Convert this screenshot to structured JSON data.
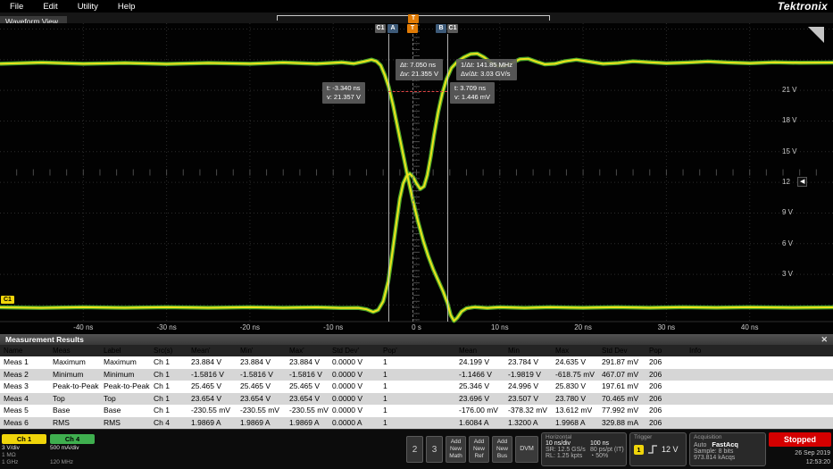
{
  "menu": {
    "items": [
      "File",
      "Edit",
      "Utility",
      "Help"
    ],
    "logo": "Tektronix"
  },
  "view_tab": "Waveform View",
  "icons": {
    "close": "✕",
    "trigger_marker": "◀",
    "position_gauge": "◔"
  },
  "plot": {
    "voltage_labels": [
      {
        "text": "21 V",
        "v": 21
      },
      {
        "text": "18 V",
        "v": 18
      },
      {
        "text": "15 V",
        "v": 15
      },
      {
        "text": "12",
        "v": 12
      },
      {
        "text": "9 V",
        "v": 9
      },
      {
        "text": "6 V",
        "v": 6
      },
      {
        "text": "3 V",
        "v": 3
      }
    ],
    "time_labels": [
      {
        "text": "-40 ns",
        "t": -40
      },
      {
        "text": "-30 ns",
        "t": -30
      },
      {
        "text": "-20 ns",
        "t": -20
      },
      {
        "text": "-10 ns",
        "t": -10
      },
      {
        "text": "0 s",
        "t": 0
      },
      {
        "text": "10 ns",
        "t": 10
      },
      {
        "text": "20 ns",
        "t": 20
      },
      {
        "text": "30 ns",
        "t": 30
      },
      {
        "text": "40 ns",
        "t": 40
      }
    ],
    "cursor_readout": {
      "delta": "Δt: 7.050 ns",
      "delta_v": "Δv: 21.355 V",
      "inv": "1/Δt: 141.85 MHz",
      "slope": "Δv/Δt: 3.03 GV/s",
      "a_t": "t: -3.340 ns",
      "a_v": "v: 21.357 V",
      "b_t": "t: 3.709 ns",
      "b_v": "v: 1.446 mV"
    },
    "markers": {
      "cursor_a": "A",
      "cursor_b": "B",
      "ch_flag": "C1",
      "trigger": "T",
      "channel_badge": "C1"
    },
    "waveforms": {
      "falling_edge": [
        [
          -50,
          23.6
        ],
        [
          -45,
          23.72
        ],
        [
          -40,
          23.6
        ],
        [
          -35,
          23.68
        ],
        [
          -30,
          23.58
        ],
        [
          -25,
          23.68
        ],
        [
          -20,
          23.6
        ],
        [
          -16,
          23.72
        ],
        [
          -12,
          23.6
        ],
        [
          -9,
          23.74
        ],
        [
          -7.5,
          23.62
        ],
        [
          -6.3,
          23.82
        ],
        [
          -5.4,
          24.0
        ],
        [
          -4.8,
          23.85
        ],
        [
          -4.3,
          23.45
        ],
        [
          -3.8,
          22.5
        ],
        [
          -3.34,
          21.36
        ],
        [
          -2.8,
          19.5
        ],
        [
          -2.2,
          17.1
        ],
        [
          -1.6,
          14.7
        ],
        [
          -1,
          12.3
        ],
        [
          -0.4,
          10.1
        ],
        [
          0.2,
          8.1
        ],
        [
          0.8,
          6.3
        ],
        [
          1.4,
          4.8
        ],
        [
          2,
          3.5
        ],
        [
          2.6,
          2.4
        ],
        [
          3.2,
          1.3
        ],
        [
          3.71,
          0.2
        ],
        [
          4.1,
          -1.0
        ],
        [
          4.5,
          -1.56
        ],
        [
          4.9,
          -1.25
        ],
        [
          5.4,
          -0.65
        ],
        [
          6,
          -0.32
        ],
        [
          7,
          -0.2
        ],
        [
          8.5,
          -0.3
        ],
        [
          10,
          -0.22
        ],
        [
          13,
          -0.28
        ],
        [
          16,
          -0.22
        ],
        [
          20,
          -0.27
        ],
        [
          24,
          -0.22
        ],
        [
          28,
          -0.27
        ],
        [
          32,
          -0.22
        ],
        [
          36,
          -0.26
        ],
        [
          40,
          -0.22
        ],
        [
          45,
          -0.26
        ],
        [
          50,
          -0.23
        ]
      ],
      "rising_edge": [
        [
          -50,
          -0.23
        ],
        [
          -45,
          -0.28
        ],
        [
          -40,
          -0.22
        ],
        [
          -35,
          -0.27
        ],
        [
          -30,
          -0.22
        ],
        [
          -25,
          -0.27
        ],
        [
          -20,
          -0.22
        ],
        [
          -16,
          -0.27
        ],
        [
          -12,
          -0.23
        ],
        [
          -9,
          -0.3
        ],
        [
          -7,
          -0.28
        ],
        [
          -6,
          -0.42
        ],
        [
          -5.2,
          -0.68
        ],
        [
          -4.6,
          -0.48
        ],
        [
          -4,
          0.35
        ],
        [
          -3.4,
          2.3
        ],
        [
          -2.9,
          5.1
        ],
        [
          -2.4,
          8.1
        ],
        [
          -2,
          10.4
        ],
        [
          -1.6,
          11.9
        ],
        [
          -1.2,
          12.6
        ],
        [
          -0.8,
          12.85
        ],
        [
          -0.4,
          12.5
        ],
        [
          0,
          11.9
        ],
        [
          0.45,
          11.35
        ],
        [
          0.9,
          11.6
        ],
        [
          1.3,
          12.7
        ],
        [
          1.7,
          14.5
        ],
        [
          2.1,
          16.6
        ],
        [
          2.6,
          18.9
        ],
        [
          3.1,
          20.7
        ],
        [
          3.6,
          22.1
        ],
        [
          4.2,
          23.2
        ],
        [
          4.9,
          23.8
        ],
        [
          5.7,
          24.25
        ],
        [
          6.5,
          24.55
        ],
        [
          7.3,
          24.6
        ],
        [
          8.1,
          24.25
        ],
        [
          8.9,
          23.75
        ],
        [
          9.7,
          23.4
        ],
        [
          10.5,
          23.35
        ],
        [
          11.4,
          23.65
        ],
        [
          12.4,
          24.05
        ],
        [
          13.4,
          24.1
        ],
        [
          14.4,
          23.8
        ],
        [
          15.4,
          23.55
        ],
        [
          16.6,
          23.6
        ],
        [
          17.8,
          23.85
        ],
        [
          19.2,
          24.0
        ],
        [
          20.8,
          23.8
        ],
        [
          22.4,
          23.6
        ],
        [
          24.2,
          23.68
        ],
        [
          26,
          23.85
        ],
        [
          28,
          23.75
        ],
        [
          30,
          23.65
        ],
        [
          32.5,
          23.72
        ],
        [
          35,
          23.82
        ],
        [
          37.5,
          23.72
        ],
        [
          40,
          23.66
        ],
        [
          43,
          23.74
        ],
        [
          46,
          23.7
        ],
        [
          50,
          23.72
        ]
      ]
    }
  },
  "measurements": {
    "title": "Measurement Results",
    "columns": [
      "Name",
      "Meas",
      "Label",
      "Src(s)",
      "Mean'",
      "Min'",
      "Max'",
      "Std Dev'",
      "Pop'",
      "Mean",
      "Min",
      "Max",
      "Std Dev",
      "Pop",
      "Info"
    ],
    "rows": [
      [
        "Meas 1",
        "Maximum",
        "Maximum",
        "Ch 1",
        "23.884 V",
        "23.884 V",
        "23.884 V",
        "0.0000 V",
        "1",
        "24.199 V",
        "23.784 V",
        "24.635 V",
        "291.87 mV",
        "206",
        ""
      ],
      [
        "Meas 2",
        "Minimum",
        "Minimum",
        "Ch 1",
        "-1.5816 V",
        "-1.5816 V",
        "-1.5816 V",
        "0.0000 V",
        "1",
        "-1.1466 V",
        "-1.9819 V",
        "-618.75 mV",
        "467.07 mV",
        "206",
        ""
      ],
      [
        "Meas 3",
        "Peak-to-Peak",
        "Peak-to-Peak",
        "Ch 1",
        "25.465 V",
        "25.465 V",
        "25.465 V",
        "0.0000 V",
        "1",
        "25.346 V",
        "24.996 V",
        "25.830 V",
        "197.61 mV",
        "206",
        ""
      ],
      [
        "Meas 4",
        "Top",
        "Top",
        "Ch 1",
        "23.654 V",
        "23.654 V",
        "23.654 V",
        "0.0000 V",
        "1",
        "23.696 V",
        "23.507 V",
        "23.780 V",
        "70.465 mV",
        "206",
        ""
      ],
      [
        "Meas 5",
        "Base",
        "Base",
        "Ch 1",
        "-230.55 mV",
        "-230.55 mV",
        "-230.55 mV",
        "0.0000 V",
        "1",
        "-176.00 mV",
        "-378.32 mV",
        "13.612 mV",
        "77.992 mV",
        "206",
        ""
      ],
      [
        "Meas 6",
        "RMS",
        "RMS",
        "Ch 4",
        "1.9869 A",
        "1.9869 A",
        "1.9869 A",
        "0.0000 A",
        "1",
        "1.6084 A",
        "1.3200 A",
        "1.9968 A",
        "329.88 mA",
        "206",
        ""
      ]
    ]
  },
  "footer": {
    "ch1": {
      "label": "Ch 1",
      "scale": "3 V/div",
      "impedance": "1 MΩ",
      "bandwidth": "1 GHz",
      "color": "#f0d50a"
    },
    "ch4": {
      "label": "Ch 4",
      "scale": "500 mA/div",
      "bandwidth": "120 MHz",
      "color": "#3faf4f"
    },
    "inactive_channels": [
      "2",
      "3"
    ],
    "add_math": "Add New Math",
    "add_ref": "Add New Ref",
    "add_bus": "Add New Bus",
    "dvm": "DVM",
    "horizontal": {
      "title": "Horizontal",
      "scale": "10 ns/div",
      "window": "100 ns",
      "sr": "SR: 12.5 GS/s",
      "resolution": "80 ps/pt (IT)",
      "rl": "RL: 1.25 kpts",
      "position": "50%"
    },
    "trigger": {
      "title": "Trigger",
      "source": "1",
      "level": "12 V"
    },
    "acquisition": {
      "title": "Acquisition",
      "mode": "Auto",
      "fast": "FastAcq",
      "sample": "Sample: 8 bits",
      "count": "973.814 kAcqs"
    },
    "status": "Stopped",
    "status_color": "#d40000",
    "date": "26 Sep 2019",
    "time": "12:53:20"
  }
}
